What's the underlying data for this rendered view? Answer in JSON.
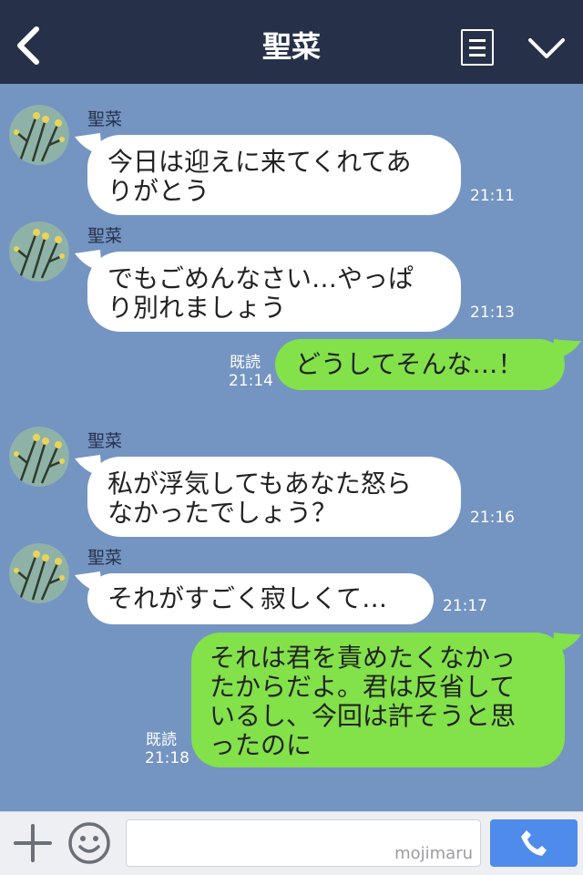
{
  "header": {
    "title": "聖菜"
  },
  "messages": [
    {
      "side": "in",
      "sender": "聖菜",
      "lines": [
        "今日は迎えに来てくれてあ",
        "りがとう"
      ],
      "time": "21:11"
    },
    {
      "side": "in",
      "sender": "聖菜",
      "lines": [
        "でもごめんなさい…やっぱ",
        "り別れましょう"
      ],
      "time": "21:13"
    },
    {
      "side": "out",
      "read": "既読",
      "lines": [
        "どうしてそんな…！"
      ],
      "time": "21:14"
    },
    {
      "side": "in",
      "sender": "聖菜",
      "lines": [
        "私が浮気してもあなた怒ら",
        "なかったでしょう？"
      ],
      "time": "21:16"
    },
    {
      "side": "in",
      "sender": "聖菜",
      "lines": [
        "それがすごく寂しくて…"
      ],
      "time": "21:17"
    },
    {
      "side": "out",
      "read": "既読",
      "lines": [
        "それは君を責めたくなかっ",
        "たからだよ。君は反省して",
        "いるし、今回は許そうと思",
        "ったのに"
      ],
      "time": "21:18"
    }
  ],
  "footer": {
    "watermark": "mojimaru"
  },
  "colors": {
    "header": "#263149",
    "background": "#7494c2",
    "outgoing": "#83e14a",
    "incoming": "#ffffff",
    "call": "#4f8bea"
  },
  "icons": {
    "back": "chevron-left-icon",
    "menu": "list-icon",
    "collapse": "chevron-down-icon",
    "add": "plus-icon",
    "emoji": "smiley-icon",
    "call": "phone-icon"
  }
}
